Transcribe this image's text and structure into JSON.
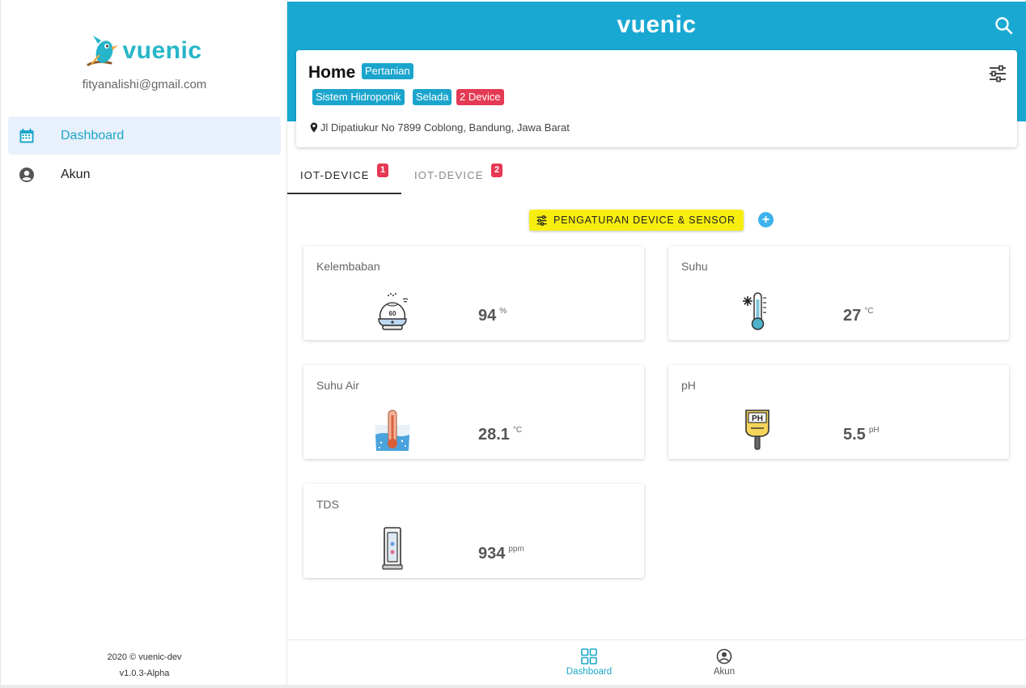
{
  "app": {
    "brand": "vuenic",
    "accent_color": "#19a8d2"
  },
  "sidebar": {
    "user_email": "fityanalishi@gmail.com",
    "items": [
      {
        "label": "Dashboard",
        "icon": "calendar-icon",
        "active": true
      },
      {
        "label": "Akun",
        "icon": "account-circle-icon",
        "active": false
      }
    ],
    "footer_line1": "2020 © vuenic-dev",
    "footer_line2": "v1.0.3-Alpha"
  },
  "header": {
    "title": "vuenic",
    "search_icon": "search-icon"
  },
  "home": {
    "title": "Home",
    "category": "Pertanian",
    "tags": [
      "Sistem Hidroponik",
      "Selada",
      "2 Device"
    ],
    "address": "Jl Dipatiukur No 7899 Coblong, Bandung, Jawa Barat"
  },
  "tabs": [
    {
      "label": "IOT-DEVICE",
      "badge": "1",
      "active": true
    },
    {
      "label": "IOT-DEVICE",
      "badge": "2",
      "active": false
    }
  ],
  "actions": {
    "settings_label": "PENGATURAN DEVICE & SENSOR",
    "add_label": "+"
  },
  "sensors": [
    {
      "name": "Kelembaban",
      "value": "94",
      "unit": "%",
      "icon": "humidifier-icon"
    },
    {
      "name": "Suhu",
      "value": "27",
      "unit": "°C",
      "icon": "thermometer-icon"
    },
    {
      "name": "Suhu Air",
      "value": "28.1",
      "unit": "°C",
      "icon": "water-temperature-icon"
    },
    {
      "name": "pH",
      "value": "5.5",
      "unit": "pH",
      "icon": "ph-meter-icon"
    },
    {
      "name": "TDS",
      "value": "934",
      "unit": "ppm",
      "icon": "tds-meter-icon"
    }
  ],
  "bottom_nav": [
    {
      "label": "Dashboard",
      "icon": "grid-icon",
      "active": true
    },
    {
      "label": "Akun",
      "icon": "account-circle-icon",
      "active": false
    }
  ]
}
